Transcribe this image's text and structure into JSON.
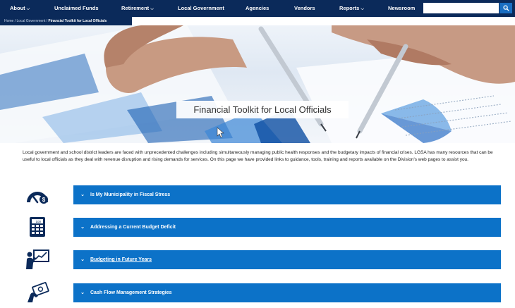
{
  "nav": {
    "items": [
      {
        "label": "About",
        "caret": true
      },
      {
        "label": "Unclaimed Funds",
        "caret": false
      },
      {
        "label": "Retirement",
        "caret": true
      },
      {
        "label": "Local Government",
        "caret": false
      },
      {
        "label": "Agencies",
        "caret": false
      },
      {
        "label": "Vendors",
        "caret": false
      },
      {
        "label": "Reports",
        "caret": true
      },
      {
        "label": "Newsroom",
        "caret": false
      }
    ],
    "search_placeholder": ""
  },
  "breadcrumb": {
    "items": [
      "Home",
      "Local Government",
      "Financial Toolkit for Local Officials"
    ],
    "separator": "/"
  },
  "hero": {
    "title": "Financial Toolkit for Local Officials"
  },
  "intro": "Local government and school district leaders are faced with unprecedented challenges including simultaneously managing public health responses and the budgetary impacts of financial crises. LGSA has many resources that can be useful to local officials as they deal with revenue disruption and rising demands for services. On this page we have provided links to guidance, tools, training and reports available on the Division's web pages to assist you.",
  "accordion": [
    {
      "label": "Is My Municipality in Fiscal Stress",
      "icon": "gauge-icon"
    },
    {
      "label": "Addressing a Current Budget Deficit",
      "icon": "calculator-icon"
    },
    {
      "label": "Budgeting in Future Years",
      "icon": "presentation-chart-icon"
    },
    {
      "label": "Cash Flow Management Strategies",
      "icon": "hand-money-icon"
    }
  ],
  "colors": {
    "nav_bg": "#0b2a5a",
    "accordion_bg": "#0c72c8",
    "icon_navy": "#0b2a5a",
    "search_btn": "#1a6ec2"
  }
}
